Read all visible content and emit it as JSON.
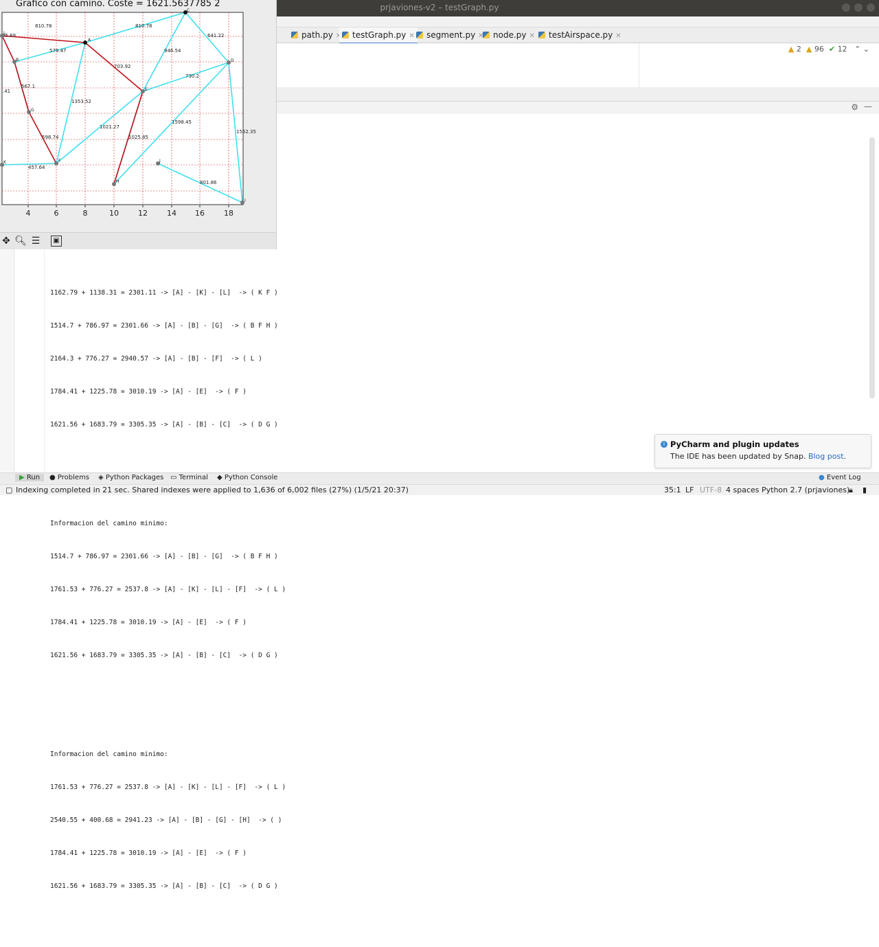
{
  "window": {
    "title": "prjaviones-v2 – testGraph.py"
  },
  "tabs": [
    {
      "label": "path.py",
      "active": false
    },
    {
      "label": "testGraph.py",
      "active": true
    },
    {
      "label": "segment.py",
      "active": false
    },
    {
      "label": "node.py",
      "active": false
    },
    {
      "label": "testAirspace.py",
      "active": false
    }
  ],
  "inspections": {
    "warnings": "2",
    "weak": "96",
    "ok": "12"
  },
  "plot": {
    "title": "Grafico con camino. Coste = 1621.5637785 2",
    "x_ticks": [
      "4",
      "6",
      "8",
      "10",
      "12",
      "14",
      "16",
      "18"
    ],
    "node_labels": [
      "A",
      "B",
      "C",
      "D",
      "E",
      "F",
      "G",
      "H",
      "I",
      "J",
      "K",
      "L"
    ],
    "edge_labels": [
      "95.69",
      "810.78",
      "810.78",
      "641.22",
      "579.47",
      "946.54",
      "703.92",
      "730.2",
      "567.1",
      ".41",
      "1353.52",
      "1021.27",
      "1598.45",
      "1562.35",
      "598.74",
      "1025.85",
      "457.64",
      "801.86"
    ]
  },
  "console": {
    "blocks": [
      {
        "header": "",
        "lines": [
          "1162.79 + 1138.31 = 2301.11 -> [A] - [K] - [L]  -> ( K F )",
          "1514.7 + 786.97 = 2301.66 -> [A] - [B] - [G]  -> ( B F H )",
          "2164.3 + 776.27 = 2940.57 -> [A] - [B] - [F]  -> ( L )",
          "1784.41 + 1225.78 = 3010.19 -> [A] - [E]  -> ( F )",
          "1621.56 + 1683.79 = 3305.35 -> [A] - [B] - [C]  -> ( D G )"
        ]
      },
      {
        "header": "Informacion del camino minimo:",
        "lines": [
          "1514.7 + 786.97 = 2301.66 -> [A] - [B] - [G]  -> ( B F H )",
          "1761.53 + 776.27 = 2537.8 -> [A] - [K] - [L] - [F]  -> ( L )",
          "1784.41 + 1225.78 = 3010.19 -> [A] - [E]  -> ( F )",
          "1621.56 + 1683.79 = 3305.35 -> [A] - [B] - [C]  -> ( D G )"
        ]
      },
      {
        "header": "Informacion del camino minimo:",
        "lines": [
          "1761.53 + 776.27 = 2537.8 -> [A] - [K] - [L] - [F]  -> ( L )",
          "2540.55 + 400.68 = 2941.23 -> [A] - [B] - [G] - [H]  -> ( )",
          "1784.41 + 1225.78 = 3010.19 -> [A] - [E]  -> ( F )",
          "1621.56 + 1683.79 = 3305.35 -> [A] - [B] - [C]  -> ( D G )"
        ]
      }
    ]
  },
  "bottom_tools": [
    "Run",
    "Problems",
    "Python Packages",
    "Terminal",
    "Python Console",
    "Event Log"
  ],
  "status": {
    "message": "Indexing completed in 21 sec. Shared indexes were applied to 1,636 of 6,002 files (27%) (1/5/21 20:37)",
    "position": "35:1",
    "line_sep": "LF",
    "encoding": "UTF-8",
    "indent": "4 spaces",
    "interpreter": "Python 2.7 (prjaviones)"
  },
  "notification": {
    "title": "PyCharm and plugin updates",
    "body": "The IDE has been updated by Snap.",
    "link": "Blog post"
  },
  "colors": {
    "path": "#c0101a",
    "edge": "#3ee0ee",
    "grid": "#cc2222",
    "accent": "#4083c9"
  }
}
